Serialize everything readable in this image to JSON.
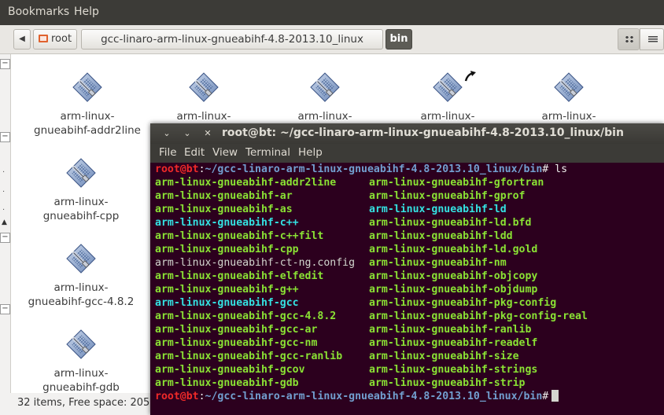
{
  "filemanager": {
    "menu": [
      "Bookmarks",
      "Help"
    ],
    "breadcrumb": {
      "root": "root",
      "path": "gcc-linaro-arm-linux-gnueabihf-4.8-2013.10_linux",
      "current": "bin"
    },
    "items": [
      {
        "line1": "arm-linux-",
        "line2": "gnueabihf-addr2line"
      },
      {
        "line1": "arm-linux-",
        "line2": ""
      },
      {
        "line1": "arm-linux-",
        "line2": ""
      },
      {
        "line1": "arm-linux-",
        "line2": ""
      },
      {
        "line1": "arm-linux-",
        "line2": ""
      },
      {
        "line1": "arm-linux-",
        "line2": "gnueabihf-cpp"
      },
      {
        "line1": "arm-linux-",
        "line2": "gnueabihf-gcc-4.8.2"
      },
      {
        "line1": "arm-linux-",
        "line2": "gnueabihf-gdb"
      }
    ],
    "status": "32 items, Free space: 205"
  },
  "terminal": {
    "title": "root@bt: ~/gcc-linaro-arm-linux-gnueabihf-4.8-2013.10_linux/bin",
    "menu": [
      "File",
      "Edit",
      "View",
      "Terminal",
      "Help"
    ],
    "prompt": {
      "user": "root@bt",
      "path": "~/gcc-linaro-arm-linux-gnueabihf-4.8-2013.10_linux/bin",
      "symbol": "#",
      "command": " ls"
    },
    "files": [
      [
        {
          "name": "arm-linux-gnueabihf-addr2line",
          "type": "exec"
        },
        {
          "name": "arm-linux-gnueabihf-gfortran",
          "type": "exec"
        }
      ],
      [
        {
          "name": "arm-linux-gnueabihf-ar",
          "type": "exec"
        },
        {
          "name": "arm-linux-gnueabihf-gprof",
          "type": "exec"
        }
      ],
      [
        {
          "name": "arm-linux-gnueabihf-as",
          "type": "exec"
        },
        {
          "name": "arm-linux-gnueabihf-ld",
          "type": "link"
        }
      ],
      [
        {
          "name": "arm-linux-gnueabihf-c++",
          "type": "link"
        },
        {
          "name": "arm-linux-gnueabihf-ld.bfd",
          "type": "exec"
        }
      ],
      [
        {
          "name": "arm-linux-gnueabihf-c++filt",
          "type": "exec"
        },
        {
          "name": "arm-linux-gnueabihf-ldd",
          "type": "exec"
        }
      ],
      [
        {
          "name": "arm-linux-gnueabihf-cpp",
          "type": "exec"
        },
        {
          "name": "arm-linux-gnueabihf-ld.gold",
          "type": "exec"
        }
      ],
      [
        {
          "name": "arm-linux-gnueabihf-ct-ng.config",
          "type": "file"
        },
        {
          "name": "arm-linux-gnueabihf-nm",
          "type": "exec"
        }
      ],
      [
        {
          "name": "arm-linux-gnueabihf-elfedit",
          "type": "exec"
        },
        {
          "name": "arm-linux-gnueabihf-objcopy",
          "type": "exec"
        }
      ],
      [
        {
          "name": "arm-linux-gnueabihf-g++",
          "type": "exec"
        },
        {
          "name": "arm-linux-gnueabihf-objdump",
          "type": "exec"
        }
      ],
      [
        {
          "name": "arm-linux-gnueabihf-gcc",
          "type": "link"
        },
        {
          "name": "arm-linux-gnueabihf-pkg-config",
          "type": "exec"
        }
      ],
      [
        {
          "name": "arm-linux-gnueabihf-gcc-4.8.2",
          "type": "exec"
        },
        {
          "name": "arm-linux-gnueabihf-pkg-config-real",
          "type": "exec"
        }
      ],
      [
        {
          "name": "arm-linux-gnueabihf-gcc-ar",
          "type": "exec"
        },
        {
          "name": "arm-linux-gnueabihf-ranlib",
          "type": "exec"
        }
      ],
      [
        {
          "name": "arm-linux-gnueabihf-gcc-nm",
          "type": "exec"
        },
        {
          "name": "arm-linux-gnueabihf-readelf",
          "type": "exec"
        }
      ],
      [
        {
          "name": "arm-linux-gnueabihf-gcc-ranlib",
          "type": "exec"
        },
        {
          "name": "arm-linux-gnueabihf-size",
          "type": "exec"
        }
      ],
      [
        {
          "name": "arm-linux-gnueabihf-gcov",
          "type": "exec"
        },
        {
          "name": "arm-linux-gnueabihf-strings",
          "type": "exec"
        }
      ],
      [
        {
          "name": "arm-linux-gnueabihf-gdb",
          "type": "exec"
        },
        {
          "name": "arm-linux-gnueabihf-strip",
          "type": "exec"
        }
      ]
    ]
  },
  "icons": {
    "file": "executable-file-icon",
    "back": "arrow-left-icon",
    "folder": "folder-icon",
    "view_icons": "icon-view-icon",
    "view_list": "list-view-icon",
    "cursor": "mouse-cursor-icon",
    "close": "close-icon",
    "minimize": "minimize-icon",
    "maximize": "maximize-icon"
  },
  "colors": {
    "prompt_user": "#ef2929",
    "prompt_path": "#729fcf",
    "exec": "#8ae234",
    "link": "#34e2e2",
    "file": "#d3d7cf",
    "terminal_bg": "#2c001e"
  }
}
